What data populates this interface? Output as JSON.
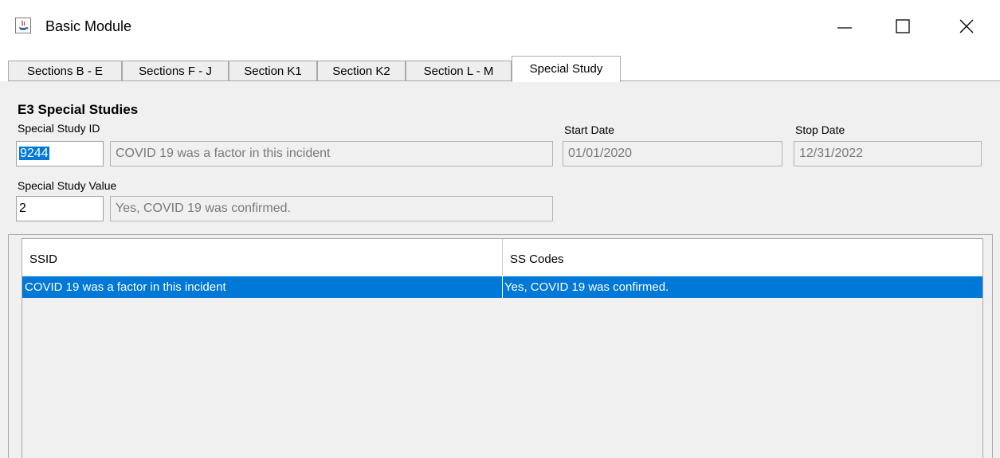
{
  "window": {
    "title": "Basic Module"
  },
  "tabs": [
    {
      "label": "Sections B - E"
    },
    {
      "label": "Sections F - J"
    },
    {
      "label": "Section K1"
    },
    {
      "label": "Section K2"
    },
    {
      "label": "Section L - M"
    },
    {
      "label": "Special Study",
      "active": true
    }
  ],
  "section": {
    "title": "E3  Special Studies",
    "special_study_id_label": "Special Study ID",
    "special_study_id_selected": "9244",
    "special_study_id_description": "COVID 19 was a factor in this incident",
    "start_date_label": "Start Date",
    "start_date": "01/01/2020",
    "stop_date_label": "Stop Date",
    "stop_date": "12/31/2022",
    "special_study_value_label": "Special Study Value",
    "special_study_value": "2",
    "special_study_value_description": "Yes, COVID 19 was confirmed."
  },
  "table": {
    "columns": [
      "SSID",
      "SS Codes"
    ],
    "rows": [
      [
        "COVID 19 was a factor in this incident",
        "Yes, COVID 19 was confirmed."
      ]
    ],
    "selected_row_color": "#0078d7"
  },
  "colors": {
    "accent": "#0078d7",
    "panel_bg": "#f0f0f0"
  }
}
